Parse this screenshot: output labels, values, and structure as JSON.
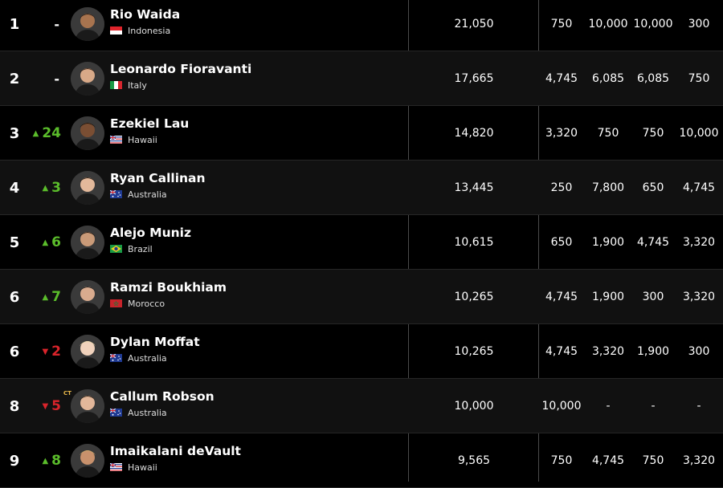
{
  "rows": [
    {
      "rank": "1",
      "move": "-",
      "dir": "none",
      "name": "Rio Waida",
      "country": "Indonesia",
      "flag": "indonesia",
      "total": "21,050",
      "e1": "750",
      "e2": "10,000",
      "e3": "10,000",
      "e4": "300",
      "badge": ""
    },
    {
      "rank": "2",
      "move": "-",
      "dir": "none",
      "name": "Leonardo Fioravanti",
      "country": "Italy",
      "flag": "italy",
      "total": "17,665",
      "e1": "4,745",
      "e2": "6,085",
      "e3": "6,085",
      "e4": "750",
      "badge": ""
    },
    {
      "rank": "3",
      "move": "24",
      "dir": "up",
      "name": "Ezekiel Lau",
      "country": "Hawaii",
      "flag": "hawaii",
      "total": "14,820",
      "e1": "3,320",
      "e2": "750",
      "e3": "750",
      "e4": "10,000",
      "badge": ""
    },
    {
      "rank": "4",
      "move": "3",
      "dir": "up",
      "name": "Ryan Callinan",
      "country": "Australia",
      "flag": "australia",
      "total": "13,445",
      "e1": "250",
      "e2": "7,800",
      "e3": "650",
      "e4": "4,745",
      "badge": ""
    },
    {
      "rank": "5",
      "move": "6",
      "dir": "up",
      "name": "Alejo Muniz",
      "country": "Brazil",
      "flag": "brazil",
      "total": "10,615",
      "e1": "650",
      "e2": "1,900",
      "e3": "4,745",
      "e4": "3,320",
      "badge": ""
    },
    {
      "rank": "6",
      "move": "7",
      "dir": "up",
      "name": "Ramzi Boukhiam",
      "country": "Morocco",
      "flag": "morocco",
      "total": "10,265",
      "e1": "4,745",
      "e2": "1,900",
      "e3": "300",
      "e4": "3,320",
      "badge": ""
    },
    {
      "rank": "6",
      "move": "2",
      "dir": "down",
      "name": "Dylan Moffat",
      "country": "Australia",
      "flag": "australia",
      "total": "10,265",
      "e1": "4,745",
      "e2": "3,320",
      "e3": "1,900",
      "e4": "300",
      "badge": ""
    },
    {
      "rank": "8",
      "move": "5",
      "dir": "down",
      "name": "Callum Robson",
      "country": "Australia",
      "flag": "australia",
      "total": "10,000",
      "e1": "10,000",
      "e2": "-",
      "e3": "-",
      "e4": "-",
      "badge": "CT"
    },
    {
      "rank": "9",
      "move": "8",
      "dir": "up",
      "name": "Imaikalani deVault",
      "country": "Hawaii",
      "flag": "hawaii",
      "total": "9,565",
      "e1": "750",
      "e2": "4,745",
      "e3": "750",
      "e4": "3,320",
      "badge": ""
    }
  ],
  "colors": {
    "up": "#5bbd2b",
    "down": "#d9242b",
    "row_alt": "#111111",
    "background": "#000000"
  },
  "icons": {
    "up": "triangle-up-icon",
    "down": "triangle-down-icon",
    "avatar": "surfer-avatar"
  }
}
